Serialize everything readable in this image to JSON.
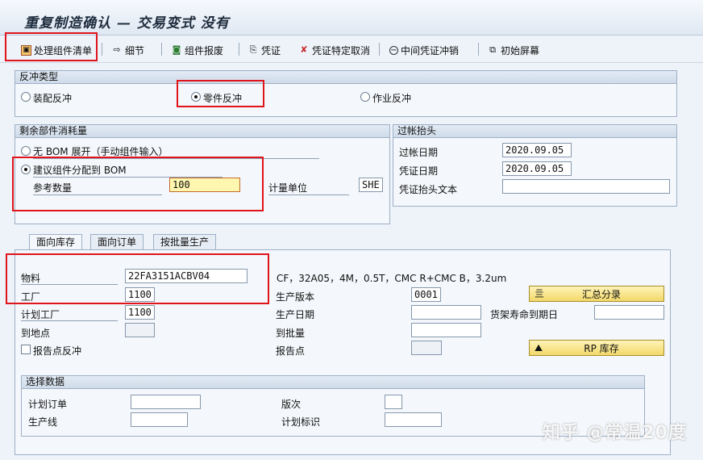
{
  "title": "重复制造确认 — 交易变式 没有",
  "toolbar": {
    "items": [
      "处理组件清单",
      "细节",
      "组件报废",
      "凭证",
      "凭证特定取消",
      "中间凭证冲销",
      "初始屏幕"
    ]
  },
  "reversal_type": {
    "header": "反冲类型",
    "options": [
      "装配反冲",
      "零件反冲",
      "作业反冲"
    ],
    "selected": "零件反冲"
  },
  "remaining": {
    "header": "剩余部件消耗量",
    "opt_no_bom": "无 BOM 展开（手动组件输入）",
    "opt_assign_bom": "建议组件分配到 BOM",
    "ref_qty_label": "参考数量",
    "ref_qty_value": "100",
    "uom_label": "计量单位",
    "uom_value": "SHE"
  },
  "posting_header": {
    "header": "过帐抬头",
    "posting_date_label": "过帐日期",
    "posting_date_value": "2020.09.05",
    "doc_date_label": "凭证日期",
    "doc_date_value": "2020.09.05",
    "header_text_label": "凭证抬头文本",
    "header_text_value": ""
  },
  "tabs": [
    "面向库存",
    "面向订单",
    "按批量生产"
  ],
  "stock_tab": {
    "material_label": "物料",
    "material_value": "22FA3151ACBV04",
    "material_desc": "CF，32A05，4M，0.5T，CMC R+CMC B，3.2um",
    "plant_label": "工厂",
    "plant_value": "1100",
    "planning_plant_label": "计划工厂",
    "planning_plant_value": "1100",
    "to_location_label": "到地点",
    "report_point_backflush_label": "报告点反冲",
    "production_version_label": "生产版本",
    "production_version_value": "0001",
    "production_date_label": "生产日期",
    "shelf_life_label": "货架寿命到期日",
    "to_batch_label": "到批量",
    "report_point_label": "报告点",
    "summary_button": "汇总分录",
    "rp_stock_button": "RP 库存"
  },
  "selection": {
    "header": "选择数据",
    "planned_order_label": "计划订单",
    "production_line_label": "生产线",
    "version_label": "版次",
    "plan_id_label": "计划标识"
  },
  "watermark": "知乎 @常温20度"
}
